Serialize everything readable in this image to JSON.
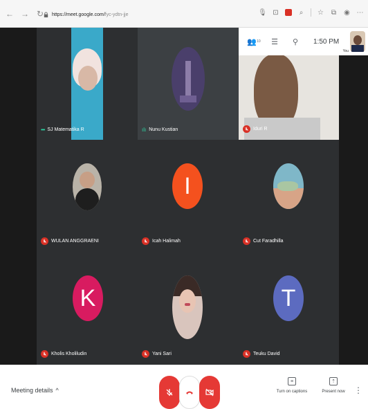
{
  "browser": {
    "url_domain": "https://meet.google.com/",
    "url_path": "fyc-ydtn-jje"
  },
  "panel": {
    "participant_count": "10",
    "time": "1:50 PM",
    "self_label": "You"
  },
  "participants": [
    {
      "name": "SJ Matematika R",
      "status": "speaking-dots"
    },
    {
      "name": "Nunu Kustian",
      "status": "speaking-bars"
    },
    {
      "name": "Iduri R",
      "status": "muted"
    },
    {
      "name": "WULAN ANGGRAENI",
      "status": "muted"
    },
    {
      "name": "Icah Halimah",
      "status": "muted",
      "letter": "I",
      "color": "#f4511e"
    },
    {
      "name": "Cut Faradhilla",
      "status": "muted"
    },
    {
      "name": "Kholis Kholiludin",
      "status": "muted",
      "letter": "K",
      "color": "#d81b60"
    },
    {
      "name": "Yani Sari",
      "status": "muted"
    },
    {
      "name": "Teuku David",
      "status": "muted",
      "letter": "T",
      "color": "#5c6bc0"
    }
  ],
  "bottom": {
    "meeting_details": "Meeting details",
    "captions_label": "Turn on captions",
    "present_label": "Present now"
  },
  "colors": {
    "end_call": "#e53935",
    "mute": "#d93025",
    "speaking": "#2bd0a0"
  }
}
